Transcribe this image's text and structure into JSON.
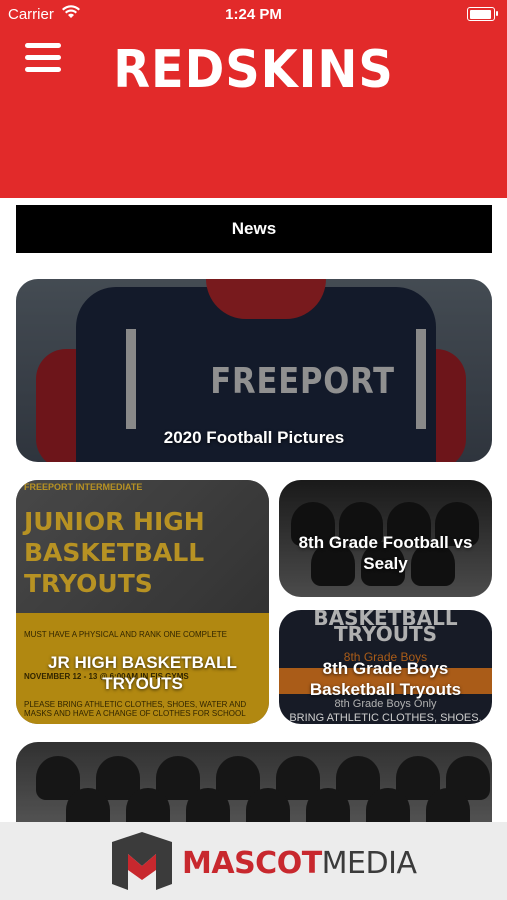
{
  "status_bar": {
    "carrier": "Carrier",
    "time": "1:24 PM"
  },
  "header": {
    "title": "REDSKINS",
    "menu_icon": "hamburger-menu-icon",
    "background": "#e22a2a"
  },
  "news_bar": {
    "label": "News"
  },
  "cards": [
    {
      "title": "2020 Football Pictures",
      "image_text": "FREEPORT"
    },
    {
      "title": "JR HIGH BASKETBALL TRYOUTS",
      "image_heading": "FREEPORT INTERMEDIATE",
      "image_big_1": "JUNIOR HIGH",
      "image_big_2": "BASKETBALL",
      "image_big_3": "TRYOUTS",
      "image_note_1": "MUST HAVE A PHYSICAL AND RANK ONE COMPLETE",
      "image_note_2": "NOVEMBER 12 - 13 @ 6:00AM IN FIS GYMS",
      "image_note_3": "PLEASE BRING ATHLETIC CLOTHES, SHOES, WATER AND MASKS AND HAVE A CHANGE OF CLOTHES FOR SCHOOL"
    },
    {
      "title": "8th Grade Football vs Sealy"
    },
    {
      "title": "8th Grade Boys Basketball Tryouts",
      "image_big_1": "BASKETBALL",
      "image_big_2": "TRYOUTS",
      "image_sub_1": "8th Grade Boys",
      "image_sub_2": "8th Grade Boys Only",
      "image_sub_3": "BRING ATHLETIC CLOTHES, SHOES, WATER ETC."
    },
    {
      "title": ""
    }
  ],
  "footer": {
    "brand_part1": "MASCOT",
    "brand_part2": "MEDIA",
    "accent": "#c8282e"
  }
}
